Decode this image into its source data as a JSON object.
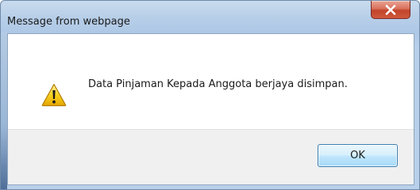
{
  "window": {
    "title": "Message from webpage",
    "close_icon": "close-x-icon"
  },
  "dialog": {
    "icon": "warning-icon",
    "message": "Data Pinjaman Kepada Anggota berjaya disimpan.",
    "ok_label": "OK"
  },
  "colors": {
    "close_button": "#c2432a",
    "ok_border": "#3c7fb1",
    "warning_yellow": "#f5c400"
  }
}
